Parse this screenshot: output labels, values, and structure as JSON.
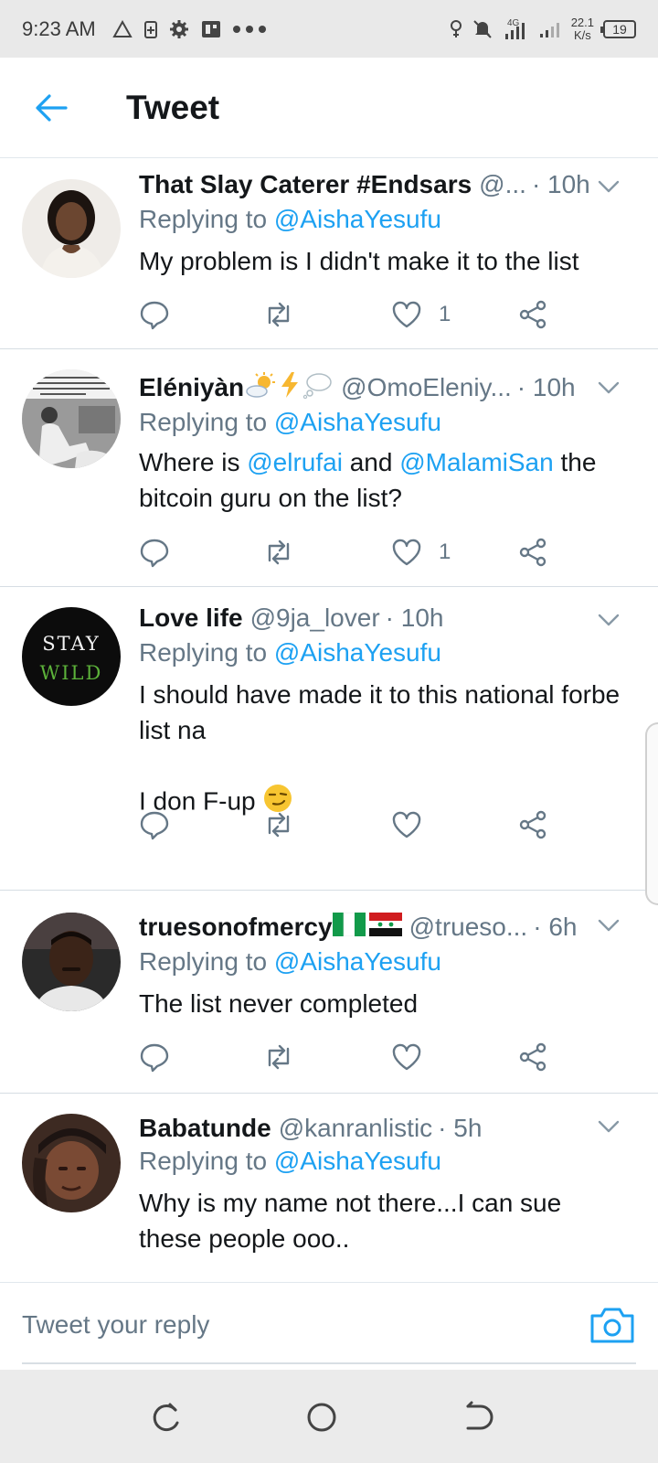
{
  "status_bar": {
    "time": "9:23 AM",
    "network_label": "4G",
    "speed_value": "22.1",
    "speed_unit": "K/s",
    "battery": "19"
  },
  "header": {
    "title": "Tweet"
  },
  "tweets": [
    {
      "name": "That Slay Caterer #Endsars",
      "handle": "@...",
      "time": "· 10h",
      "reply_prefix": "Replying to ",
      "reply_to": "@AishaYesufu",
      "body": "My problem is I didn't make it to the list",
      "likes": "1"
    },
    {
      "name": "Eléniyàn",
      "handle": "@OmoEleniy...",
      "time": "· 10h",
      "reply_prefix": "Replying to ",
      "reply_to": "@AishaYesufu",
      "body_1": "Where is ",
      "mention_1": "@elrufai",
      "body_2": " and ",
      "mention_2": "@MalamiSan",
      "body_3": " the bitcoin guru on the list?",
      "likes": "1"
    },
    {
      "name": "Love life",
      "handle": "@9ja_lover",
      "time": "· 10h",
      "reply_prefix": "Replying to ",
      "reply_to": "@AishaYesufu",
      "body_line1": "I should have made it to this national forbe list na",
      "body_line2": "I don F-up",
      "avatar_text_1": "STAY",
      "avatar_text_2": "WILD",
      "likes": ""
    },
    {
      "name": "truesonofmercy",
      "handle": "@trueso...",
      "time": "· 6h",
      "reply_prefix": "Replying to ",
      "reply_to": "@AishaYesufu",
      "body": "The list never completed",
      "likes": ""
    },
    {
      "name": "Babatunde",
      "handle": "@kanranlistic",
      "time": "· 5h",
      "reply_prefix": "Replying to ",
      "reply_to": "@AishaYesufu",
      "body": "Why is my name not there...I can sue these people ooo..",
      "likes": ""
    }
  ],
  "reply_bar": {
    "placeholder": "Tweet your reply"
  },
  "colors": {
    "accent": "#1da1f2",
    "text": "#14171a",
    "muted": "#657786"
  }
}
